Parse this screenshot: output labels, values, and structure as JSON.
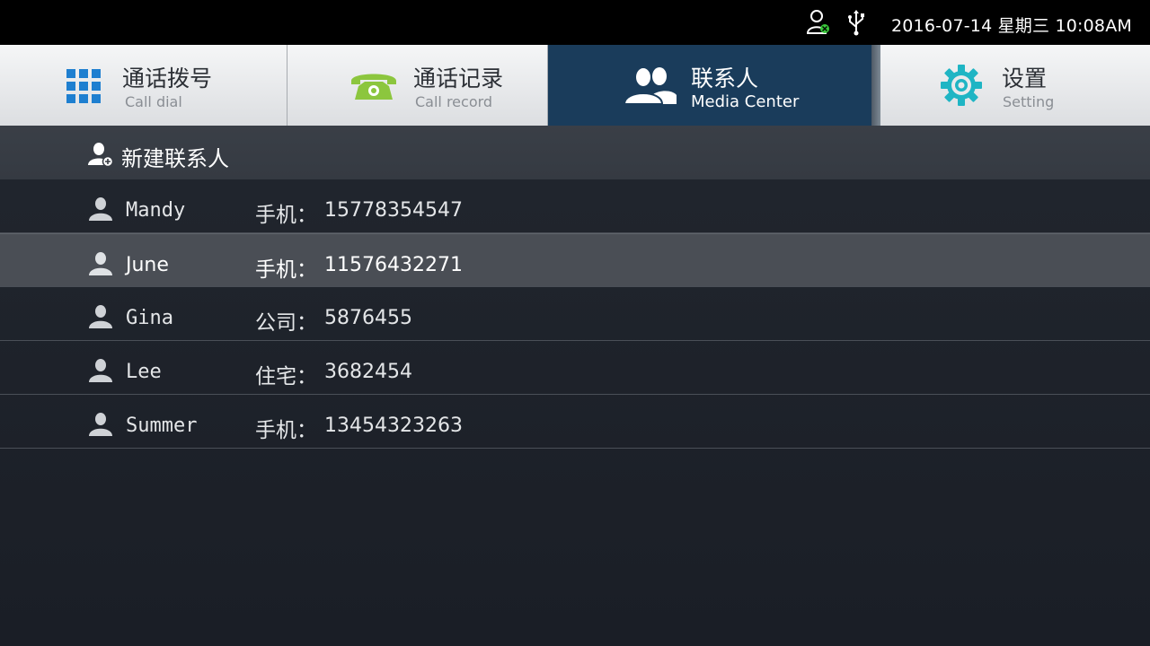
{
  "status_bar": {
    "datetime": "2016-07-14  星期三  10:08AM",
    "icons": [
      "user-status-icon",
      "usb-icon"
    ]
  },
  "tabs": [
    {
      "title": "通话拨号",
      "subtitle": "Call dial",
      "icon": "dialpad-icon",
      "active": false
    },
    {
      "title": "通话记录",
      "subtitle": "Call record",
      "icon": "telephone-icon",
      "active": false
    },
    {
      "title": "联系人",
      "subtitle": "Media Center",
      "icon": "contacts-icon",
      "active": true
    },
    {
      "title": "设置",
      "subtitle": "Setting",
      "icon": "gear-icon",
      "active": false
    }
  ],
  "new_contact": {
    "label": "新建联系人",
    "icon": "add-person-icon"
  },
  "contacts": [
    {
      "name": "Mandy",
      "type": "手机：",
      "number": "15778354547",
      "selected": false
    },
    {
      "name": "June",
      "type": "手机：",
      "number": "11576432271",
      "selected": true
    },
    {
      "name": "Gina",
      "type": "公司：",
      "number": "5876455",
      "selected": false
    },
    {
      "name": "Lee",
      "type": "住宅：",
      "number": "3682454",
      "selected": false
    },
    {
      "name": "Summer",
      "type": "手机：",
      "number": "13454323263",
      "selected": false
    }
  ],
  "colors": {
    "active_tab": "#1a3c5b",
    "dialpad_blue": "#1e7fd0",
    "phone_green": "#8cc63e",
    "gear_teal": "#1fb5c4",
    "status_green": "#39c93a"
  }
}
